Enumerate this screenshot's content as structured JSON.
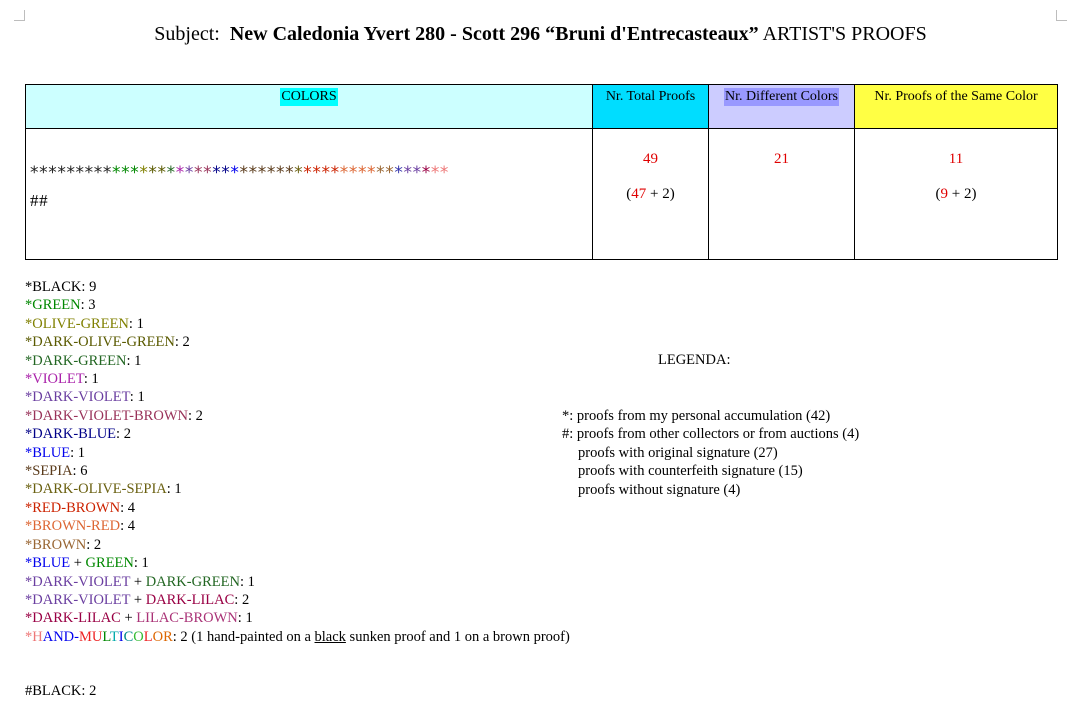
{
  "title": {
    "prefix": "Subject:",
    "bold": "New Caledonia Yvert 280 - Scott 296 “Bruni d'Entrecasteaux”",
    "suffix": "ARTIST'S PROOFS"
  },
  "table": {
    "headers": {
      "colors": "COLORS",
      "total": "Nr. Total Proofs",
      "different": "Nr. Different Colors",
      "same": "Nr. Proofs of the Same Color"
    },
    "star_colors": [
      "#222222",
      "#222222",
      "#222222",
      "#222222",
      "#222222",
      "#222222",
      "#222222",
      "#222222",
      "#222222",
      "#008800",
      "#008800",
      "#008800",
      "#808000",
      "#5a5a00",
      "#5a5a00",
      "#226622",
      "#aa22aa",
      "#6a3ea0",
      "#99335a",
      "#99335a",
      "#000088",
      "#000088",
      "#0000ee",
      "#5a3a1a",
      "#5a3a1a",
      "#5a3a1a",
      "#5a3a1a",
      "#5a3a1a",
      "#5a3a1a",
      "#6a6010",
      "#cc2200",
      "#cc2200",
      "#cc2200",
      "#cc2200",
      "#dd6633",
      "#dd6633",
      "#dd6633",
      "#dd6633",
      "#996633",
      "#996633",
      "#3333aa",
      "#6a3ea0",
      "#6a3ea0",
      "#990044",
      "#ee7777",
      "#ee7777"
    ],
    "hash_mark": "##",
    "total": "49",
    "total_main": "47",
    "total_extra": "2",
    "different": "21",
    "same": "11",
    "same_main": "9",
    "same_extra": "2"
  },
  "colors_list": [
    {
      "mark": "*",
      "name": "BLACK",
      "count": "9"
    },
    {
      "mark": "*",
      "name": "GREEN",
      "count": "3"
    },
    {
      "mark": "*",
      "name": "OLIVE-GREEN",
      "count": "1"
    },
    {
      "mark": "*",
      "name": "DARK-OLIVE-GREEN",
      "count": "2"
    },
    {
      "mark": "*",
      "name": "DARK-GREEN",
      "count": "1"
    },
    {
      "mark": "*",
      "name": "VIOLET",
      "count": "1"
    },
    {
      "mark": "*",
      "name": "DARK-VIOLET",
      "count": "1"
    },
    {
      "mark": "*",
      "name": "DARK-VIOLET-BROWN",
      "count": "2"
    },
    {
      "mark": "*",
      "name": "DARK-BLUE",
      "count": "2"
    },
    {
      "mark": "*",
      "name": "BLUE",
      "count": "1"
    },
    {
      "mark": "*",
      "name": "SEPIA",
      "count": "6"
    },
    {
      "mark": "*",
      "name": "DARK-OLIVE-SEPIA",
      "count": "1"
    },
    {
      "mark": "*",
      "name": "RED-BROWN",
      "count": "4"
    },
    {
      "mark": "*",
      "name": "BROWN-RED",
      "count": "4"
    },
    {
      "mark": "*",
      "name": "BROWN",
      "count": "2"
    },
    {
      "mark": "*",
      "name_a": "BLUE",
      "plus": "+",
      "name_b": "GREEN",
      "count": "1"
    },
    {
      "mark": "*",
      "name_a": "DARK-VIOLET",
      "plus": "+",
      "name_b": "DARK-GREEN",
      "count": "1"
    },
    {
      "mark": "*",
      "name_a": "DARK-VIOLET",
      "plus": "+",
      "name_b": "DARK-LILAC",
      "count": "2"
    },
    {
      "mark": "*",
      "name_a": "DARK-LILAC",
      "plus": "+",
      "name_b": "LILAC-BROWN",
      "count": "1"
    },
    {
      "mark": "*",
      "parts": [
        "H",
        "AND-",
        "MU",
        "L",
        "T",
        "I",
        "C",
        "O",
        "L",
        "OR"
      ],
      "count": "2",
      "note_a": "(1 hand-painted on a",
      "note_u": "black",
      "note_b": "sunken proof and 1 on a brown proof)"
    }
  ],
  "other_list": [
    {
      "mark": "#",
      "name": "BLACK",
      "count": "2"
    }
  ],
  "legend": {
    "title": "LEGENDA:",
    "lines": [
      "*: proofs from my personal accumulation (42)",
      "#: proofs from other collectors or from auctions (4)",
      "proofs with original signature (27)",
      "proofs with counterfeith signature (15)",
      "proofs without signature (4)"
    ]
  }
}
